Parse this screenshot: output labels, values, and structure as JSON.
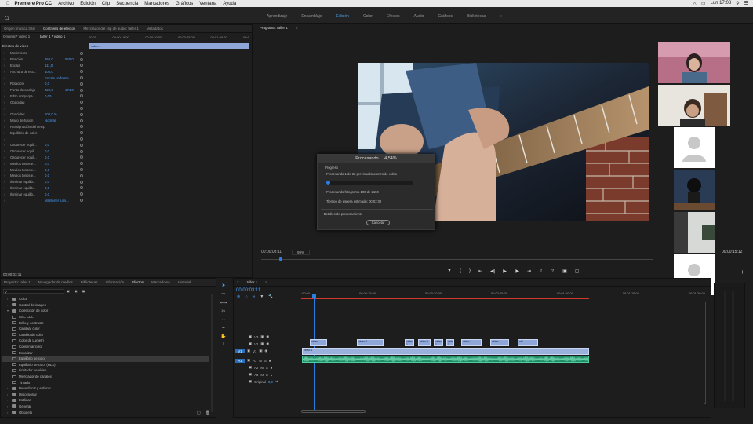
{
  "menubar": {
    "apple": "",
    "app": "Premiere Pro CC",
    "items": [
      "Archivo",
      "Edición",
      "Clip",
      "Secuencia",
      "Marcadores",
      "Gráficos",
      "Ventana",
      "Ayuda"
    ],
    "clock": "Lun 17:08"
  },
  "workspaces": {
    "tabs": [
      "Aprendizaje",
      "Ensamblaje",
      "Edición",
      "Color",
      "Efectos",
      "Audio",
      "Gráficos",
      "Bibliotecas"
    ],
    "active": "Edición"
  },
  "effect_controls": {
    "tabs": [
      "Origen: musica.fotel",
      "Controles de efectos",
      "Mezclador del clip de audio: taller 1",
      "Metadatos"
    ],
    "clip_label": "Original * video 1",
    "seq_label": "taller 1 * video 1",
    "ruler": [
      "00:00",
      "00:00:15:00",
      "00:00:30:00",
      "00:00:45:00",
      "00:01:00:00",
      "00:0"
    ],
    "clip_name": "video 1",
    "section_video": "Efectos de video",
    "rows": [
      {
        "label": "Movimiento",
        "value": "",
        "value2": ""
      },
      {
        "label": "Posición",
        "value": "960,0",
        "value2": "540,0"
      },
      {
        "label": "Escala",
        "value": "111,0",
        "value2": ""
      },
      {
        "label": "Anchura de esc...",
        "value": "100,0",
        "value2": ""
      },
      {
        "label": "",
        "value": "Escala uniforme",
        "value2": ""
      },
      {
        "label": "Rotación",
        "value": "0,0",
        "value2": ""
      },
      {
        "label": "Punto de anclaje",
        "value": "320,0",
        "value2": "174,0"
      },
      {
        "label": "Filtro antiparpa...",
        "value": "0,00",
        "value2": ""
      },
      {
        "label": "Opacidad",
        "value": "",
        "value2": ""
      },
      {
        "label": "",
        "value": "",
        "value2": ""
      },
      {
        "label": "Opacidad",
        "value": "100,0 %",
        "value2": ""
      },
      {
        "label": "Modo de fusión",
        "value": "Normal",
        "value2": ""
      },
      {
        "label": "Reasignación del tiempo",
        "value": "",
        "value2": ""
      },
      {
        "label": "Equilibrio de color",
        "value": "",
        "value2": ""
      },
      {
        "label": "",
        "value": "",
        "value2": ""
      },
      {
        "label": "Oscurecer equil...",
        "value": "0,0",
        "value2": ""
      },
      {
        "label": "Oscurecer equil...",
        "value": "0,0",
        "value2": ""
      },
      {
        "label": "Oscurecer equil...",
        "value": "0,0",
        "value2": ""
      },
      {
        "label": "Medios tonos e...",
        "value": "0,0",
        "value2": ""
      },
      {
        "label": "Medios tonos e...",
        "value": "0,0",
        "value2": ""
      },
      {
        "label": "Medios tonos e...",
        "value": "0,0",
        "value2": ""
      },
      {
        "label": "Iluminar equilib...",
        "value": "0,0",
        "value2": ""
      },
      {
        "label": "Iluminar equilib...",
        "value": "0,0",
        "value2": ""
      },
      {
        "label": "Iluminar equilib...",
        "value": "0,0",
        "value2": ""
      },
      {
        "label": "",
        "value": "Mantener lumi...",
        "value2": ""
      }
    ],
    "timecode": "00:00:03:11"
  },
  "program": {
    "tab": "Programa: taller 1",
    "timecode": "00:00:03:11",
    "zoom": "99%",
    "duration": "00:00:15:12"
  },
  "dialog": {
    "title": "Procesando",
    "percent": "4,54%",
    "progress_label": "Progreso",
    "line1": "Procesando 1 de 22 previsualizaciones de vídeo",
    "line2": "Procesando fotograma 100 de 2150",
    "line3": "Tiempo de espera estimado: 00:02:02",
    "details": "Detalles de procesamiento",
    "cancel": "Cancelar",
    "progress": 0.0454
  },
  "effects_panel": {
    "tabs": [
      "Proyecto: taller 1",
      "Navegador de medios",
      "Bibliotecas",
      "Información",
      "Efectos",
      "Marcadores",
      "Historial"
    ],
    "items": [
      {
        "label": "Coice",
        "type": "folder",
        "indent": 1
      },
      {
        "label": "Control de imagen",
        "type": "folder",
        "indent": 1
      },
      {
        "label": "Corrección de color",
        "type": "folder",
        "indent": 1,
        "open": true
      },
      {
        "label": "ASC CDL",
        "type": "fx",
        "indent": 2
      },
      {
        "label": "Brillo y contraste",
        "type": "fx",
        "indent": 2
      },
      {
        "label": "Cambiar color",
        "type": "fx",
        "indent": 2
      },
      {
        "label": "Cambio de color",
        "type": "fx",
        "indent": 2
      },
      {
        "label": "Color de Lumetri",
        "type": "fx",
        "indent": 2
      },
      {
        "label": "Conservar color",
        "type": "fx",
        "indent": 2
      },
      {
        "label": "Ecualizar",
        "type": "fx",
        "indent": 2
      },
      {
        "label": "Equilibrio de color",
        "type": "fx",
        "indent": 2,
        "selected": true
      },
      {
        "label": "Equilibrio de color (HLS)",
        "type": "fx",
        "indent": 2
      },
      {
        "label": "Limitador de vídeo",
        "type": "fx",
        "indent": 2
      },
      {
        "label": "Mezclador de canales",
        "type": "fx",
        "indent": 2
      },
      {
        "label": "Tintado",
        "type": "fx",
        "indent": 2
      },
      {
        "label": "Desenfocar y enfocar",
        "type": "folder",
        "indent": 1
      },
      {
        "label": "Distorsionar",
        "type": "folder",
        "indent": 1
      },
      {
        "label": "Estilizar",
        "type": "folder",
        "indent": 1
      },
      {
        "label": "Generar",
        "type": "folder",
        "indent": 1
      },
      {
        "label": "Obsoleto",
        "type": "folder",
        "indent": 1
      }
    ]
  },
  "timeline": {
    "tab": "taller 1",
    "timecode": "00:00:03:11",
    "ruler": [
      ":00:00",
      "00:00:15:00",
      "00:00:30:00",
      "00:00:45:00",
      "00:01:00:00",
      "00:01:15:00",
      "00:01:30:00"
    ],
    "tracks": [
      "V3",
      "V2",
      "V1",
      "A1",
      "A2",
      "A3",
      "Original"
    ],
    "master_value": "0,0",
    "clip_label": "video 1",
    "v2_clips": [
      "video",
      "video 1",
      "video 1",
      "video 1",
      "video 1",
      "video 1",
      "video 1",
      "video 1",
      "vid"
    ]
  },
  "colors": {
    "accent": "#2b7fe0",
    "timecode": "#4aa0ff",
    "clip_video": "#8fa6d8",
    "clip_audio": "#23a47a",
    "render_bar": "#d03a2a"
  }
}
